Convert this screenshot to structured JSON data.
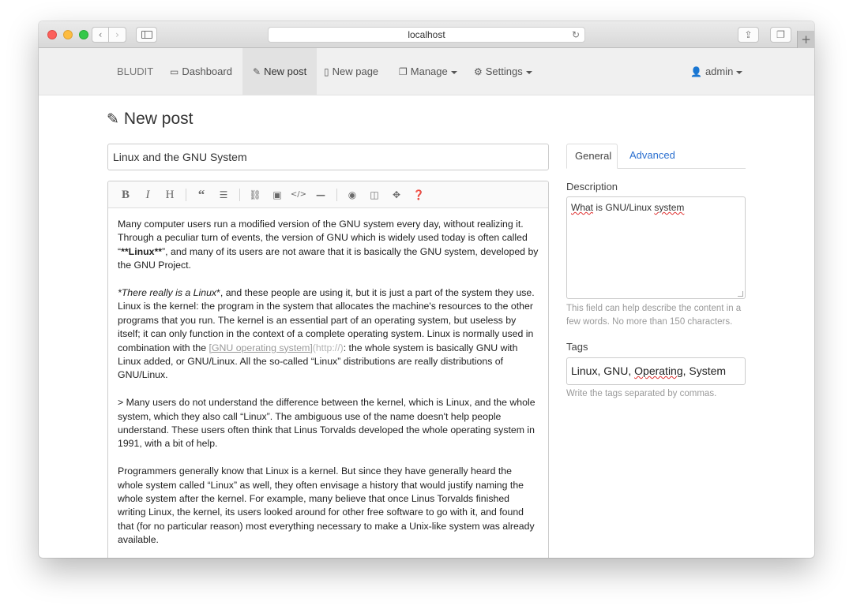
{
  "browser": {
    "url": "localhost"
  },
  "navbar": {
    "brand": "BLUDIT",
    "items": [
      {
        "label": "Dashboard",
        "icon": "dashboard-icon"
      },
      {
        "label": "New post",
        "icon": "pencil-icon"
      },
      {
        "label": "New page",
        "icon": "file-icon"
      },
      {
        "label": "Manage",
        "icon": "copy-icon"
      },
      {
        "label": "Settings",
        "icon": "gear-icon"
      }
    ],
    "user": "admin"
  },
  "page": {
    "title": "New post"
  },
  "post": {
    "title_value": "Linux and the GNU System"
  },
  "editor": {
    "toolbar": [
      "bold",
      "italic",
      "heading",
      "quote",
      "unordered-list",
      "link",
      "image",
      "code",
      "horizontal-rule",
      "preview",
      "side-by-side",
      "fullscreen",
      "guide"
    ],
    "paragraphs": {
      "p1": "Many computer users run a modified version of the GNU system every day, without realizing it. Through a peculiar turn of events, the version of GNU which is widely used today is often called “",
      "p1_bold": "**Linux**",
      "p1_end": "”, and many of its users are not aware that it is basically the GNU system, developed by the GNU Project.",
      "p2_italic": "*There really is a Linux",
      "p2_a": "*, and these people are using it, but it is just a part of the system they use. Linux is the kernel: the program in the system that allocates the machine's resources to the other programs that you run. The kernel is an essential part of an operating system, but useless by itself; it can only function in the context of a complete operating system. Linux is normally used in combination with the ",
      "p2_link": "[GNU operating system]",
      "p2_url": "(http://)",
      "p2_b": ": the whole system is basically GNU with Linux added, or GNU/Linux. All the so-called “Linux” distributions are really distributions of GNU/Linux.",
      "p3": "> Many users do not understand the difference between the kernel, which is Linux, and the whole system, which they also call “Linux”. The ambiguous use of the name doesn't help people understand. These users often think that Linus Torvalds developed the whole operating system in 1991, with a bit of help.",
      "p4": "Programmers generally know that Linux is a kernel. But since they have generally heard the whole system called “Linux” as well, they often envisage a history that would justify naming the whole system after the kernel. For example, many believe that once Linus Torvalds finished writing Linux, the kernel, its users looked around for other free software to go with it, and found that (for no particular reason) most everything necessary to make a Unix-like system was already available."
    }
  },
  "sidebar": {
    "tabs": [
      "General",
      "Advanced"
    ],
    "description": {
      "label": "Description",
      "value_a": "What",
      "value_b": " is GNU/Linux ",
      "value_c": "system",
      "help": "This field can help describe the content in a few words. No more than 150 characters."
    },
    "tags": {
      "label": "Tags",
      "value_a": "Linux, GNU, ",
      "value_b": "Operating",
      "value_c": ", System",
      "help": "Write the tags separated by commas."
    }
  }
}
